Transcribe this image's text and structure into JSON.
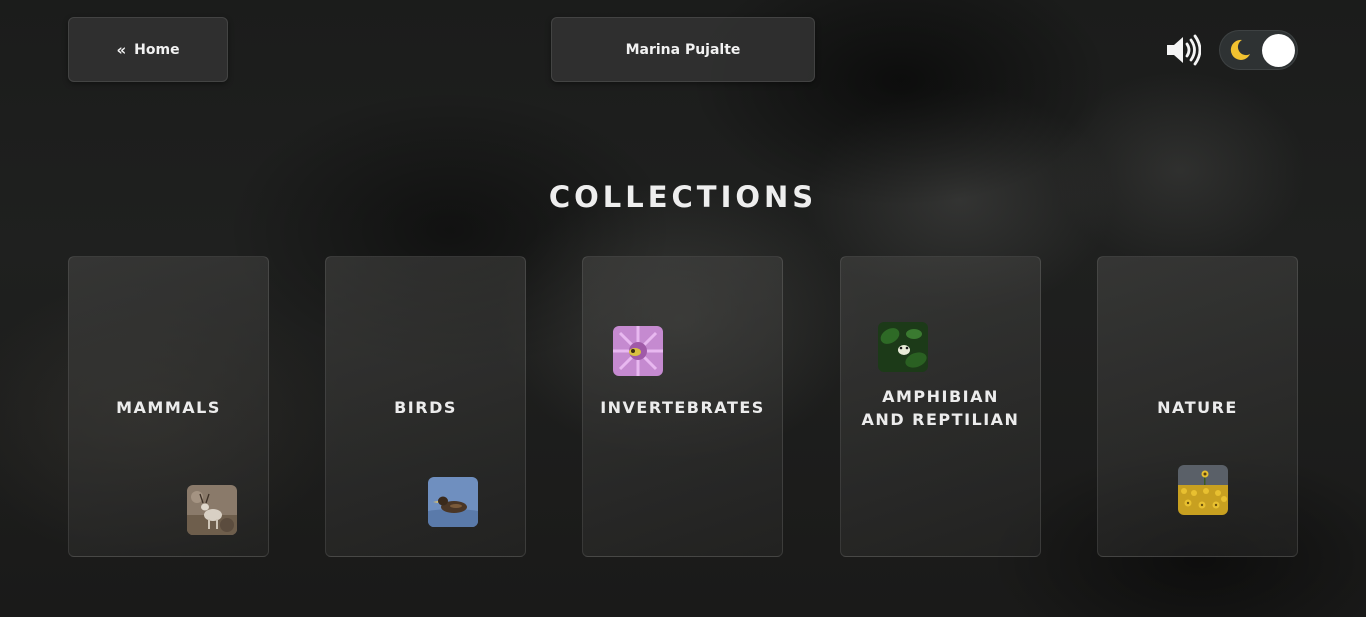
{
  "header": {
    "home_label": "Home",
    "user_name": "Marina Pujalte"
  },
  "page": {
    "title": "COLLECTIONS"
  },
  "collections": [
    {
      "label": "MAMMALS",
      "thumb_icon": "deer-thumbnail"
    },
    {
      "label": "BIRDS",
      "thumb_icon": "duck-thumbnail"
    },
    {
      "label": "INVERTEBRATES",
      "thumb_icon": "insect-on-flower-thumbnail"
    },
    {
      "label": "AMPHIBIAN AND REPTILIAN",
      "thumb_icon": "frog-thumbnail"
    },
    {
      "label": "NATURE",
      "thumb_icon": "sunflower-field-thumbnail"
    }
  ],
  "theme": {
    "mode": "dark",
    "accent": "#f2c230"
  }
}
